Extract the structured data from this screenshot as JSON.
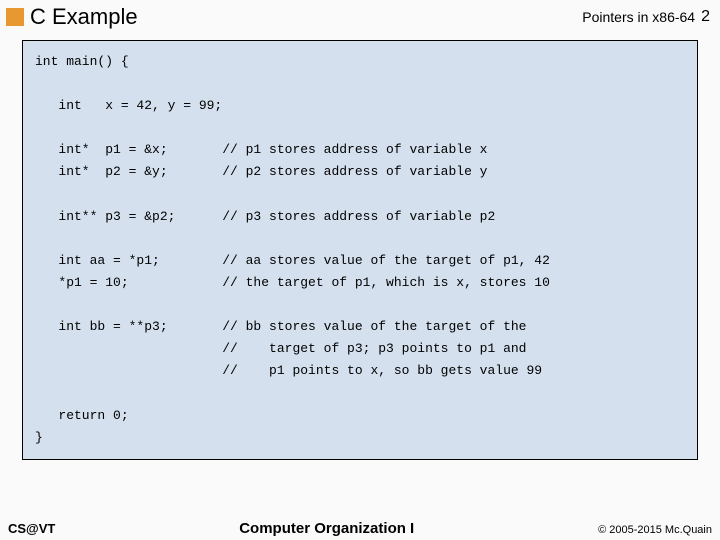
{
  "header": {
    "title": "C Example",
    "topic": "Pointers in x86-64",
    "page": "2"
  },
  "code": "int main() {\n\n   int   x = 42, y = 99;\n\n   int*  p1 = &x;       // p1 stores address of variable x\n   int*  p2 = &y;       // p2 stores address of variable y\n\n   int** p3 = &p2;      // p3 stores address of variable p2\n\n   int aa = *p1;        // aa stores value of the target of p1, 42\n   *p1 = 10;            // the target of p1, which is x, stores 10\n\n   int bb = **p3;       // bb stores value of the target of the\n                        //    target of p3; p3 points to p1 and\n                        //    p1 points to x, so bb gets value 99\n\n   return 0;\n}",
  "footer": {
    "left": "CS@VT",
    "center": "Computer Organization I",
    "right": "© 2005-2015 Mc.Quain"
  }
}
